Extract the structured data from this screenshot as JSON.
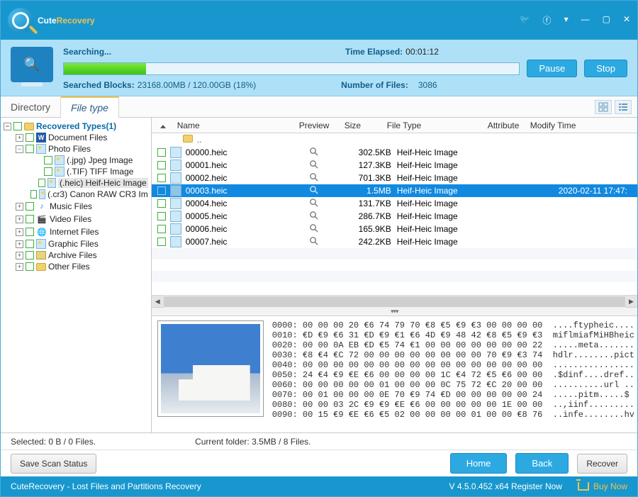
{
  "titlebar": {
    "app_name_1": "Cute",
    "app_name_2": "Recovery"
  },
  "status": {
    "searching": "Searching...",
    "time_label": "Time Elapsed:",
    "time_value": "00:01:12",
    "pause": "Pause",
    "stop": "Stop",
    "blocks_label": "Searched Blocks:",
    "blocks_value": "23168.00MB / 120.00GB (18%)",
    "files_label": "Number of Files:",
    "files_value": "3086"
  },
  "tabs": {
    "directory": "Directory",
    "filetype": "File type"
  },
  "tree": {
    "root": "Recovered Types(1)",
    "doc": "Document Files",
    "photo": "Photo Files",
    "jpg": "(.jpg) Jpeg Image",
    "tif": "(.TIF) TIFF Image",
    "heic": "(.heic) Heif-Heic Image",
    "cr3": "(.cr3) Canon RAW CR3 Im",
    "music": "Music Files",
    "video": "Video Files",
    "inet": "Internet Files",
    "graphic": "Graphic Files",
    "archive": "Archive Files",
    "other": "Other Files"
  },
  "columns": {
    "name": "Name",
    "preview": "Preview",
    "size": "Size",
    "type": "File Type",
    "attr": "Attribute",
    "mod": "Modify Time"
  },
  "dots": "..",
  "files": [
    {
      "name": "00000.heic",
      "size": "302.5KB",
      "type": "Heif-Heic Image",
      "mod": ""
    },
    {
      "name": "00001.heic",
      "size": "127.3KB",
      "type": "Heif-Heic Image",
      "mod": ""
    },
    {
      "name": "00002.heic",
      "size": "701.3KB",
      "type": "Heif-Heic Image",
      "mod": ""
    },
    {
      "name": "00003.heic",
      "size": "1.5MB",
      "type": "Heif-Heic Image",
      "mod": "2020-02-11 17:47:"
    },
    {
      "name": "00004.heic",
      "size": "131.7KB",
      "type": "Heif-Heic Image",
      "mod": ""
    },
    {
      "name": "00005.heic",
      "size": "286.7KB",
      "type": "Heif-Heic Image",
      "mod": ""
    },
    {
      "name": "00006.heic",
      "size": "165.9KB",
      "type": "Heif-Heic Image",
      "mod": ""
    },
    {
      "name": "00007.heic",
      "size": "242.2KB",
      "type": "Heif-Heic Image",
      "mod": ""
    }
  ],
  "hex": "0000: 00 00 00 20 €6 74 79 70 €8 €5 €9 €3 00 00 00 00  ....ftypheic....\n0010: €D €9 €6 31 €D €9 €1 €6 4D €9 48 42 €8 €5 €9 €3  miflmiafMiHBheic\n0020: 00 00 0A EB €D €5 74 €1 00 00 00 00 00 00 00 22  .....meta.......\n0030: €8 €4 €C 72 00 00 00 00 00 00 00 00 70 €9 €3 74  hdlr........pict\n0040: 00 00 00 00 00 00 00 00 00 00 00 00 00 00 00 00  ................\n0050: 24 €4 €9 €E €6 00 00 00 00 1C €4 72 €5 €6 00 00  .$dinf....dref..\n0060: 00 00 00 00 00 01 00 00 00 0C 75 72 €C 20 00 00  ..........url ..\n0070: 00 01 00 00 00 0E 70 €9 74 €D 00 00 00 00 00 24  .....pitm.....$\n0080: 00 00 03 2C €9 €9 €E €6 00 00 00 00 00 1E 00 00  ..,iinf.........\n0090: 00 15 €9 €E €6 €5 02 00 00 00 00 01 00 00 €8 76  ..infe........hv",
  "statusbar": {
    "selected": "Selected: 0 B / 0 Files.",
    "current": "Current folder: 3.5MB / 8 Files."
  },
  "actions": {
    "save": "Save Scan Status",
    "home": "Home",
    "back": "Back",
    "recover": "Recover"
  },
  "bottom": {
    "tagline": "CuteRecovery - Lost Files and Partitions Recovery",
    "version": "V 4.5.0.452 x64  Register Now",
    "buy": "Buy Now"
  }
}
